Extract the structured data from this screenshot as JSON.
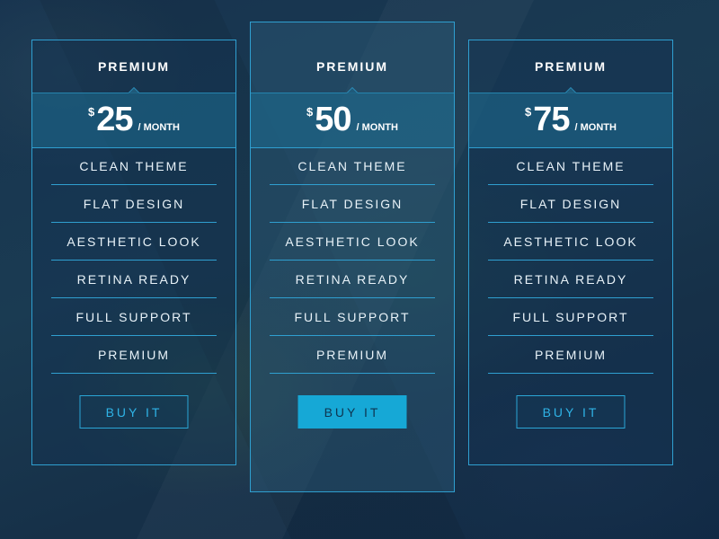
{
  "colors": {
    "accent": "#2f9fd0",
    "button_solid": "#16a8d6",
    "background": "#13304d"
  },
  "plans": [
    {
      "name": "PREMIUM",
      "currency": "$",
      "amount": "25",
      "period": "/ MONTH",
      "features": [
        "CLEAN THEME",
        "FLAT DESIGN",
        "AESTHETIC LOOK",
        "RETINA READY",
        "FULL SUPPORT",
        "PREMIUM"
      ],
      "button_label": "BUY IT"
    },
    {
      "name": "PREMIUM",
      "currency": "$",
      "amount": "50",
      "period": "/ MONTH",
      "features": [
        "CLEAN THEME",
        "FLAT DESIGN",
        "AESTHETIC LOOK",
        "RETINA READY",
        "FULL SUPPORT",
        "PREMIUM"
      ],
      "button_label": "BUY IT"
    },
    {
      "name": "PREMIUM",
      "currency": "$",
      "amount": "75",
      "period": "/ MONTH",
      "features": [
        "CLEAN THEME",
        "FLAT DESIGN",
        "AESTHETIC LOOK",
        "RETINA READY",
        "FULL SUPPORT",
        "PREMIUM"
      ],
      "button_label": "BUY IT"
    }
  ]
}
